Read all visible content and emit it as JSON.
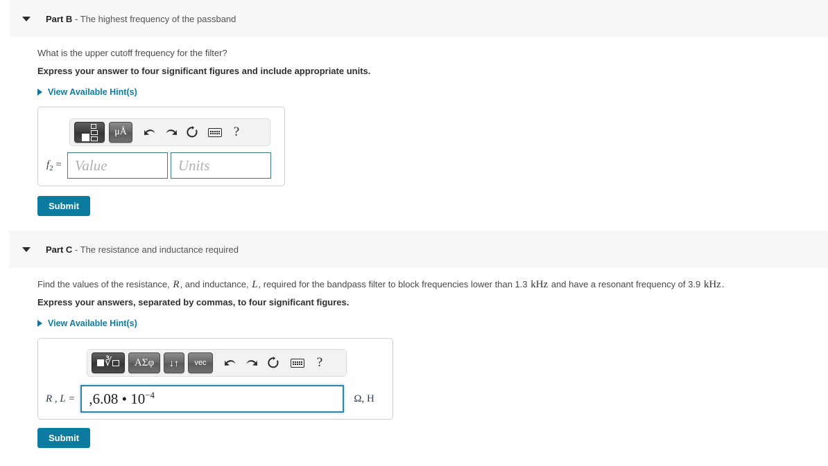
{
  "parts": {
    "b": {
      "label": "Part B",
      "dash": " - ",
      "subtitle": "The highest frequency of the passband",
      "question": "What is the upper cutoff frequency for the filter?",
      "instruction": "Express your answer to four significant figures and include appropriate units.",
      "hint_label": "View Available Hint(s)",
      "answer_label_var": "f",
      "answer_label_sub": "2",
      "answer_label_eq": " =",
      "value_placeholder": "Value",
      "units_placeholder": "Units",
      "submit_label": "Submit",
      "toolbar": {
        "template_button": "template-insert",
        "units_button": "μÅ",
        "undo": "undo-arrow",
        "redo": "redo-arrow",
        "reset": "reset-arrow",
        "keyboard": "keyboard",
        "help": "?"
      }
    },
    "c": {
      "label": "Part C",
      "dash": " - ",
      "subtitle": "The resistance and inductance required",
      "question_seg1": "Find the values of the resistance, ",
      "question_var1": "R",
      "question_seg2": ", and inductance, ",
      "question_var2": "L",
      "question_seg3": ", required for the bandpass filter to block frequencies lower than 1.3 ",
      "question_unit1": "kHz",
      "question_seg4": " and have a resonant frequency of 3.9 ",
      "question_unit2": "kHz",
      "question_seg5": ".",
      "instruction": "Express your answers, separated by commas, to four significant figures.",
      "hint_label": "View Available Hint(s)",
      "answer_label": "R , L =",
      "answer_value_mantissa": ",6.08 • 10",
      "answer_value_exponent": "−4",
      "units_suffix": "Ω, H",
      "submit_label": "Submit",
      "toolbar": {
        "template_button": "nth-root-template",
        "greek_button": "ΑΣφ",
        "arrows_button": "↓↑",
        "vec_button": "vec",
        "undo": "undo-arrow",
        "redo": "redo-arrow",
        "reset": "reset-arrow",
        "keyboard": "keyboard",
        "help": "?"
      }
    }
  },
  "colors": {
    "accent_link": "#0f7b9e",
    "submit_bg": "#0b7ba0",
    "header_bg": "#f7f7f7",
    "input_border": "#3d7b8c",
    "focus_border": "#2f87a8"
  }
}
